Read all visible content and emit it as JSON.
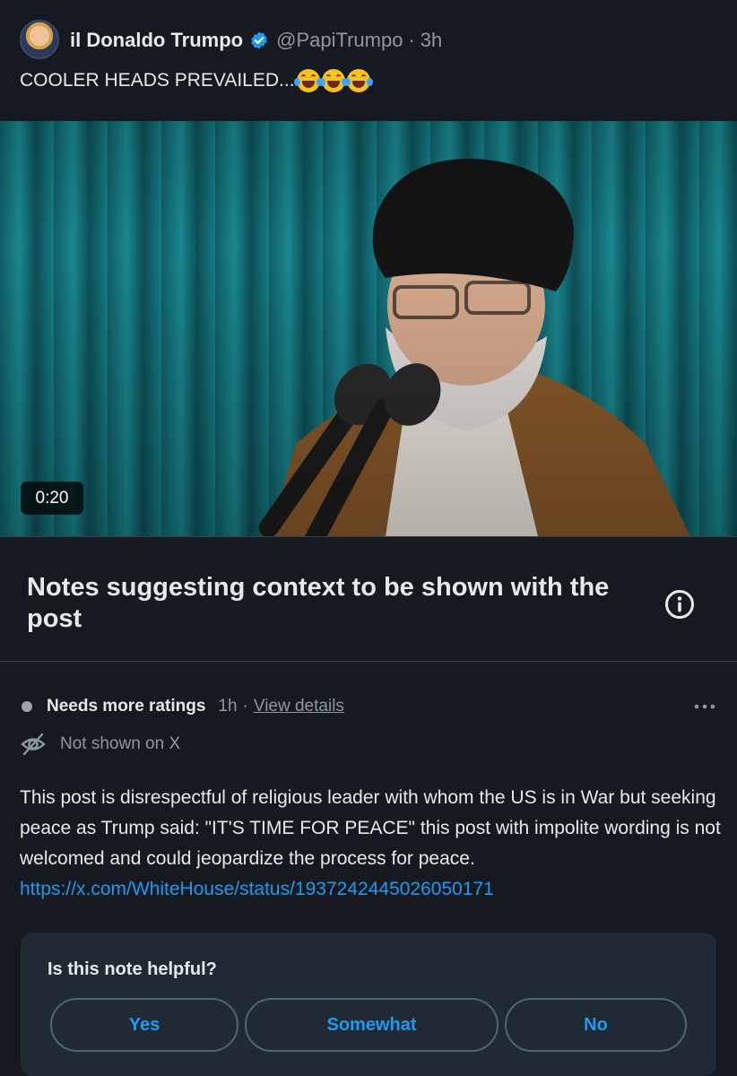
{
  "post": {
    "author_name": "il Donaldo Trumpo",
    "handle": "@PapiTrumpo",
    "separator": "·",
    "time_ago": "3h",
    "text": "COOLER HEADS PREVAILED...",
    "emoji_count": 3,
    "emoji": "face-with-tears-of-joy-icon"
  },
  "video": {
    "duration": "0:20"
  },
  "notes": {
    "title": "Notes suggesting context to be shown with the post",
    "info_icon": "info-icon"
  },
  "note": {
    "status_label": "Needs more ratings",
    "time_ago": "1h",
    "separator": "·",
    "view_details": "View details",
    "visibility": "Not shown on X",
    "body": "This post is disrespectful of religious leader with whom the US is in War but seeking peace as Trump said: \"IT'S TIME FOR PEACE\" this post with impolite wording is not welcomed and could jeopardize the process for peace.",
    "link": "https://x.com/WhiteHouse/status/1937242445026050171"
  },
  "rating": {
    "question": "Is this note helpful?",
    "yes": "Yes",
    "somewhat": "Somewhat",
    "no": "No"
  },
  "colors": {
    "background": "#15202b",
    "accent": "#1d9bf0",
    "muted": "#8b98a5",
    "verified": "#1d9bf0"
  }
}
